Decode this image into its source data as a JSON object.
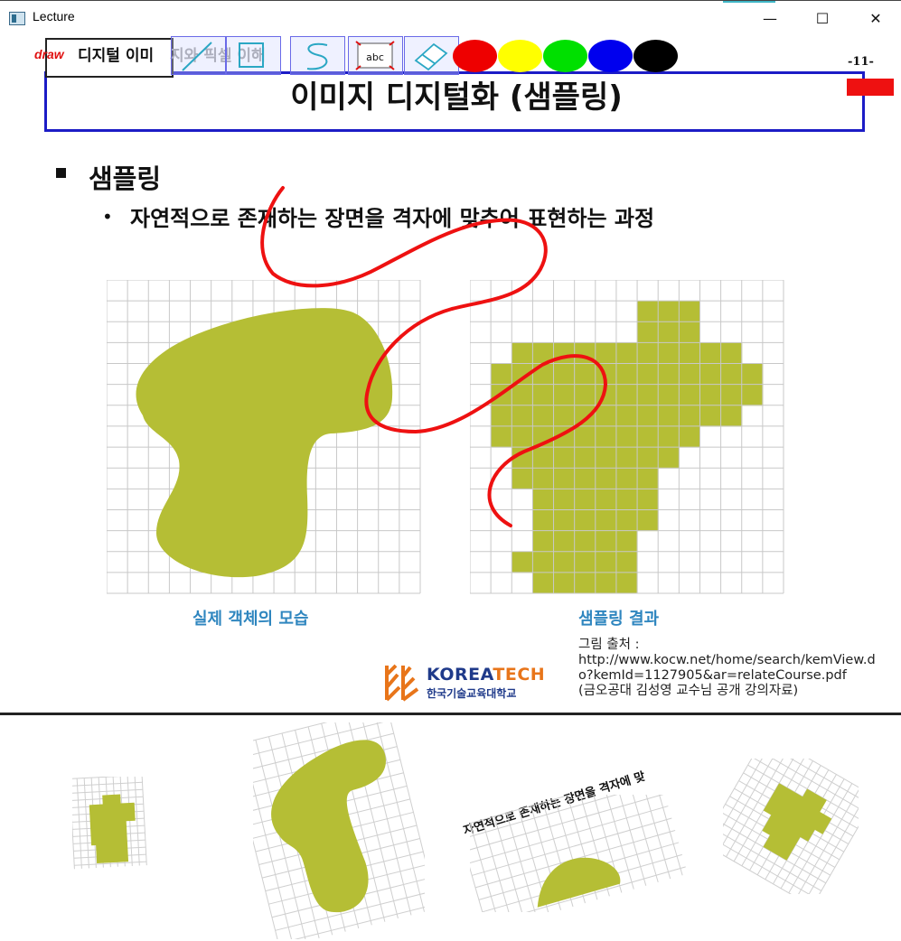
{
  "window": {
    "title": "Lecture",
    "minimize_glyph": "—",
    "maximize_glyph": "☐",
    "close_glyph": "✕"
  },
  "toolbar": {
    "draw_label": "draw",
    "tab_title": "디지털 이미",
    "tab_title_overflow": "지와 픽셀 이해",
    "tools": [
      {
        "name": "line-tool-icon"
      },
      {
        "name": "rectangle-tool-icon"
      },
      {
        "name": "freehand-tool-icon"
      },
      {
        "name": "text-tool-icon",
        "text": "abc"
      },
      {
        "name": "eraser-tool-icon"
      }
    ],
    "colors": [
      "#ee0000",
      "#ffff00",
      "#00e000",
      "#0000ee",
      "#000000"
    ]
  },
  "slide": {
    "page_number": "-11-",
    "title": "이미지 디지털화 (샘플링)",
    "heading": "샘플링",
    "bullet": "자연적으로 존재하는 장면을 격자에 맞추어 표현하는 과정",
    "caption_left": "실제 객체의 모습",
    "caption_right": "샘플링 결과",
    "source_label": "그림 출처 :",
    "source_url": "http://www.kocw.net/home/search/kemView.do?kemId=1127905&ar=relateCourse.pdf",
    "source_note": "(금오공대 김성영 교수님 공개 강의자료)",
    "logo_name_1": "KOREA",
    "logo_name_2": "TECH",
    "logo_sub": "한국기술교육대학교",
    "shape_color": "#b5be35",
    "annotation_color": "#ee0000"
  },
  "lower": {
    "rotated_text": "자연적으로 존재하는 장면을 격자에 맞"
  }
}
